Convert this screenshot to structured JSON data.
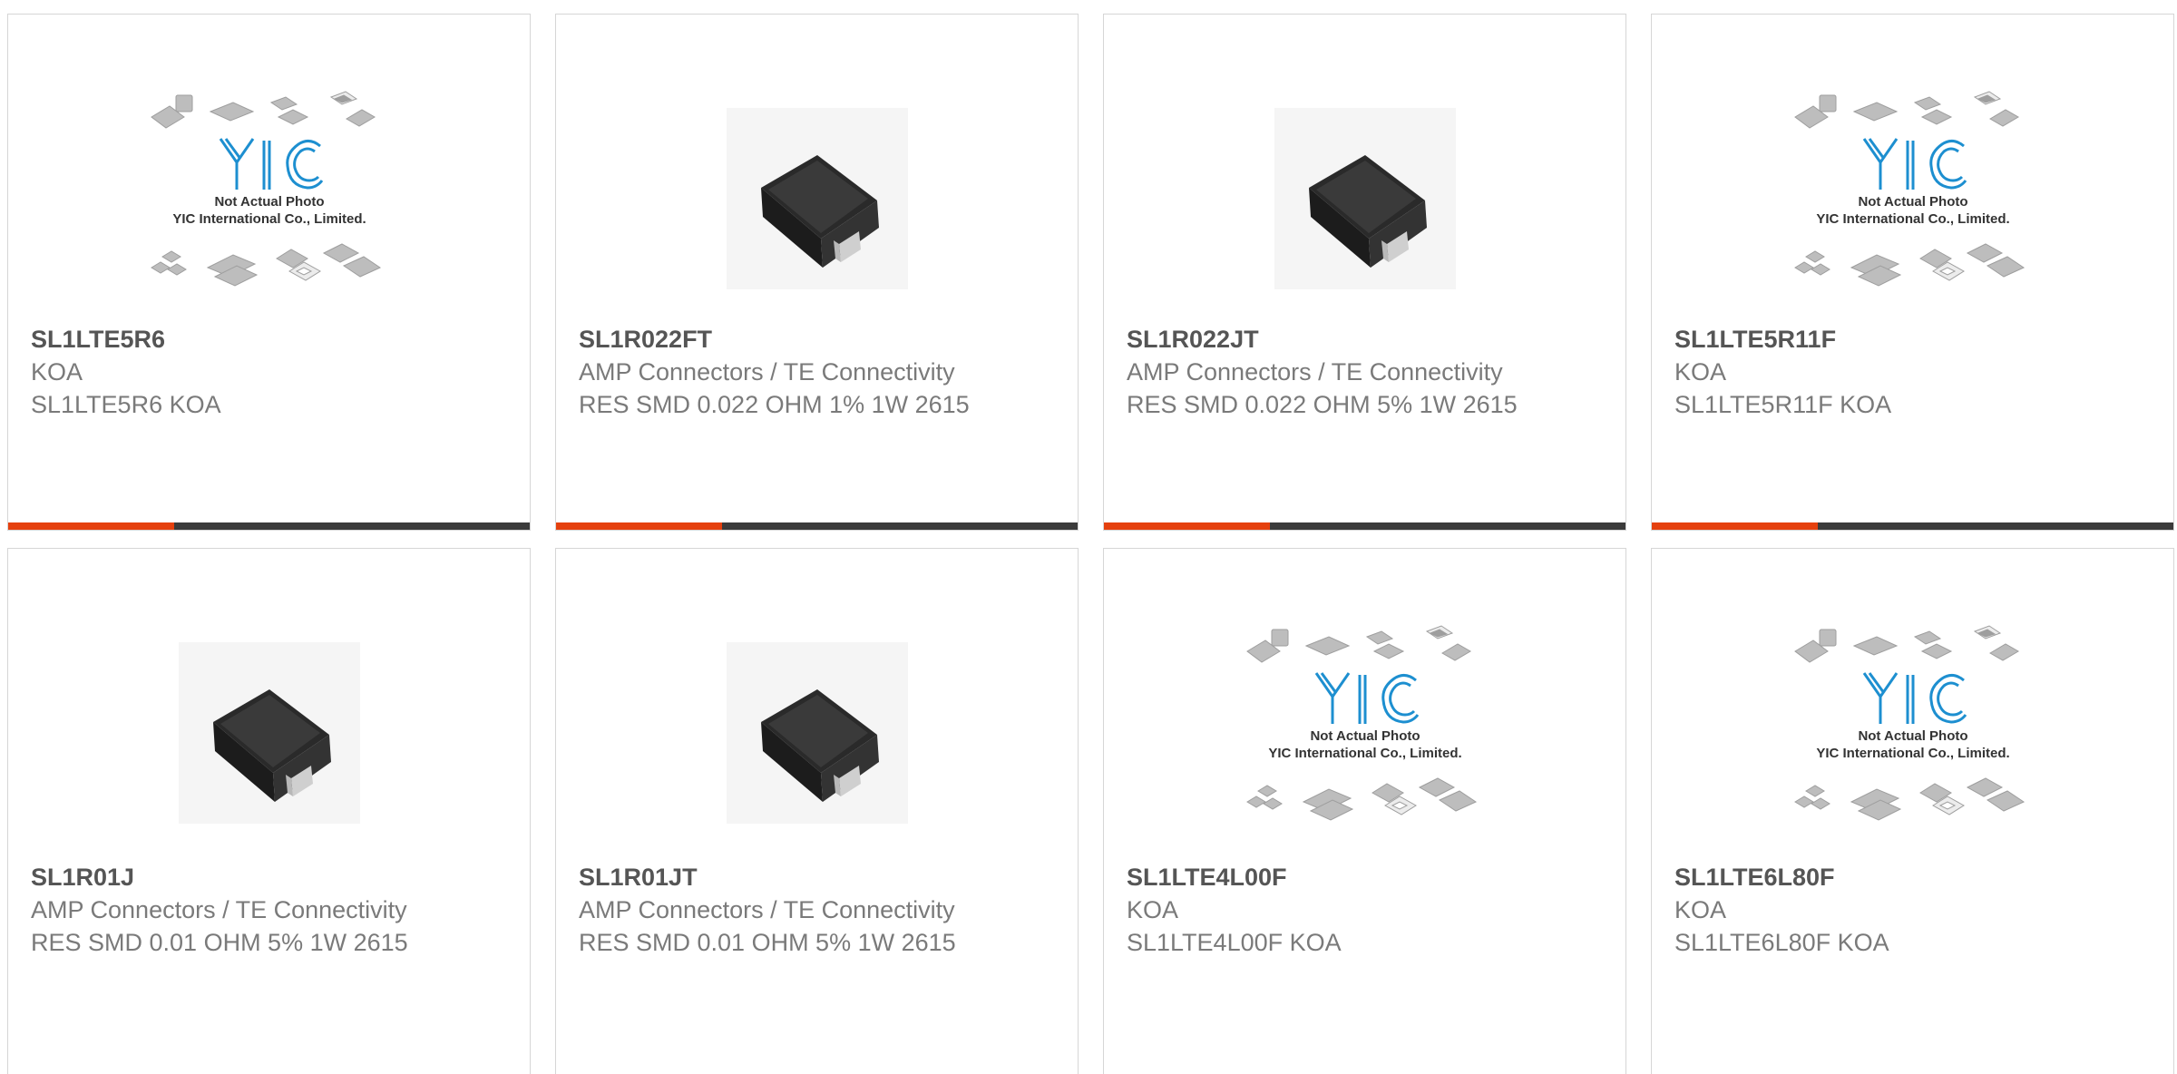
{
  "colors": {
    "accent": "#e5400e",
    "bar": "#3b3b3b",
    "logo": "#1d8fd0"
  },
  "placeholder": {
    "logo": "YIC",
    "line1": "Not Actual Photo",
    "line2": "YIC International Co., Limited."
  },
  "products": [
    {
      "pn": "SL1LTE5R6",
      "mfr": "KOA",
      "desc": "SL1LTE5R6 KOA",
      "image": "placeholder"
    },
    {
      "pn": "SL1R022FT",
      "mfr": "AMP Connectors / TE Connectivity",
      "desc": "RES SMD 0.022 OHM 1% 1W 2615",
      "image": "resistor"
    },
    {
      "pn": "SL1R022JT",
      "mfr": "AMP Connectors / TE Connectivity",
      "desc": "RES SMD 0.022 OHM 5% 1W 2615",
      "image": "resistor"
    },
    {
      "pn": "SL1LTE5R11F",
      "mfr": "KOA",
      "desc": "SL1LTE5R11F KOA",
      "image": "placeholder"
    },
    {
      "pn": "SL1R01J",
      "mfr": "AMP Connectors / TE Connectivity",
      "desc": "RES SMD 0.01 OHM 5% 1W 2615",
      "image": "resistor"
    },
    {
      "pn": "SL1R01JT",
      "mfr": "AMP Connectors / TE Connectivity",
      "desc": "RES SMD 0.01 OHM 5% 1W 2615",
      "image": "resistor"
    },
    {
      "pn": "SL1LTE4L00F",
      "mfr": "KOA",
      "desc": "SL1LTE4L00F KOA",
      "image": "placeholder"
    },
    {
      "pn": "SL1LTE6L80F",
      "mfr": "KOA",
      "desc": "SL1LTE6L80F KOA",
      "image": "placeholder"
    }
  ]
}
